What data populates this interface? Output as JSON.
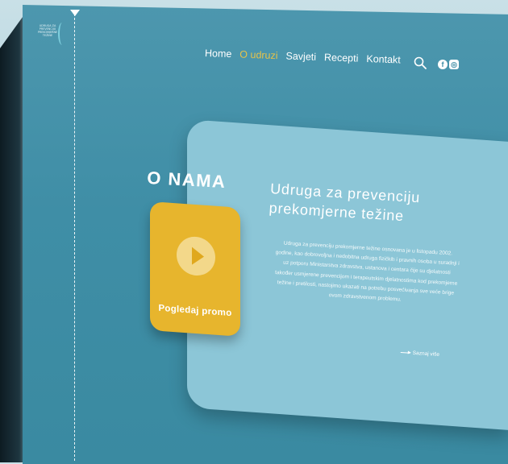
{
  "brand": {
    "logo_lines": [
      "UDRUGA ZA",
      "PREVENCIJU",
      "PREKOMJERNE",
      "TEŽINE"
    ]
  },
  "nav": {
    "items": [
      {
        "label": "Home",
        "active": false
      },
      {
        "label": "O udruzi",
        "active": true
      },
      {
        "label": "Savjeti",
        "active": false
      },
      {
        "label": "Recepti",
        "active": false
      },
      {
        "label": "Kontakt",
        "active": false
      }
    ],
    "search_icon": "search-icon",
    "social": [
      {
        "icon": "facebook-icon",
        "glyph": "f"
      },
      {
        "icon": "instagram-icon",
        "glyph": "◎"
      }
    ]
  },
  "page": {
    "title": "O NAMA"
  },
  "promo": {
    "label": "Pogledaj promo",
    "icon": "play-icon"
  },
  "about": {
    "heading": "Udruga za prevenciju prekomjerne težine",
    "body": "Udruga za prevenciju prekomjerne težine osnovana je u listopadu 2002. godine, kao dobrovoljna i nedobitna udruga fizičkih i pravnih osoba u suradnji i uz potporu Ministarstva zdravstva, ustanova i centara čije su djelatnosti također usmjerene prevencijom i terapeutskim djelatnostima kod prekomjerne težine i pretilosti, nastojimo ukazati na potrebu posvećivanja sve veće brige ovom zdravstvenom problemu.",
    "more_label": "Saznaj više"
  },
  "colors": {
    "background": "#3f8ea6",
    "panel": "#8cc6d7",
    "accent": "#e6c34a",
    "promo": "#e7b52d"
  }
}
